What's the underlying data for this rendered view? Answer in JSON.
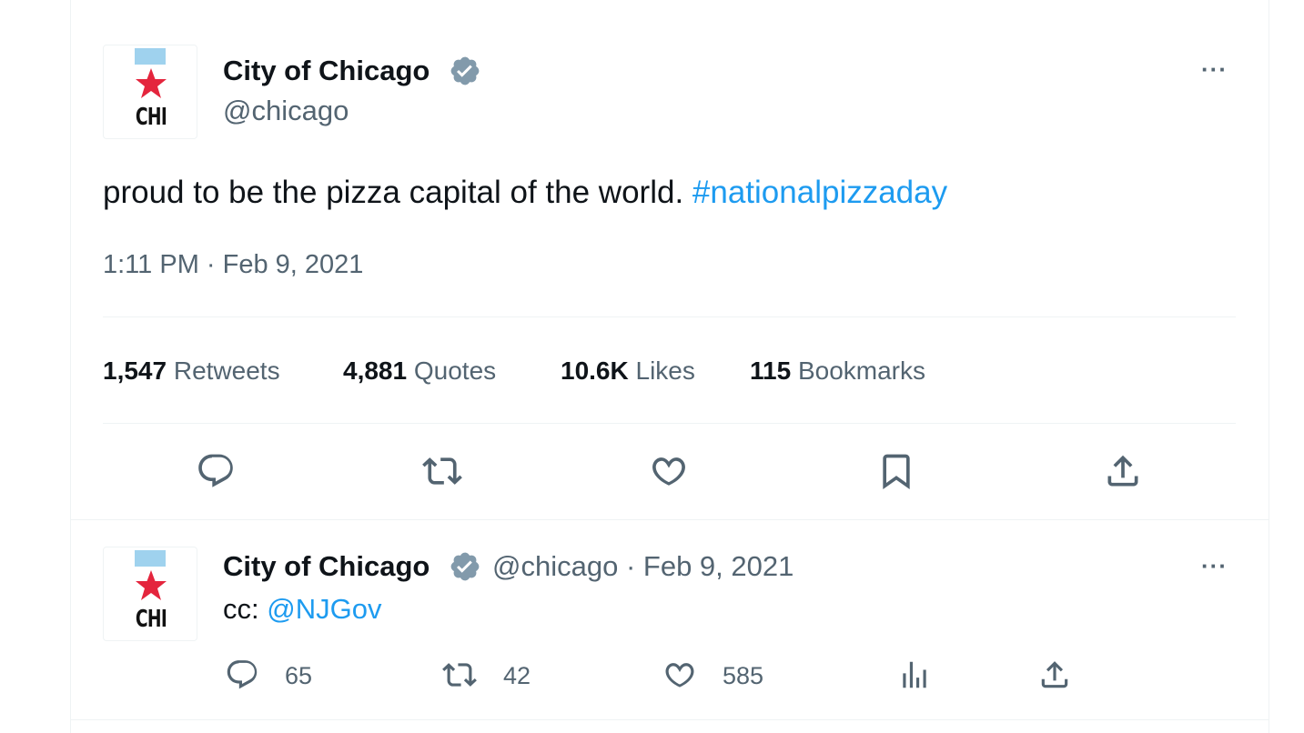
{
  "main_tweet": {
    "author": {
      "name": "City of Chicago",
      "handle": "@chicago",
      "avatar_text": "CHI",
      "verified_icon": "verified-badge-icon"
    },
    "more_label": "···",
    "text_main": "proud to be the pizza capital of the world. ",
    "hashtag": "#nationalpizzaday",
    "timestamp": "1:11 PM · Feb 9, 2021",
    "stats": [
      {
        "value": "1,547",
        "label": "Retweets"
      },
      {
        "value": "4,881",
        "label": "Quotes"
      },
      {
        "value": "10.6K",
        "label": "Likes"
      },
      {
        "value": "115",
        "label": "Bookmarks"
      }
    ],
    "actions": [
      "reply-icon",
      "retweet-icon",
      "like-icon",
      "bookmark-icon",
      "share-icon"
    ]
  },
  "reply_tweet": {
    "author": {
      "name": "City of Chicago",
      "handle": "@chicago",
      "date": "· Feb 9, 2021",
      "avatar_text": "CHI"
    },
    "more_label": "···",
    "text_prefix": "cc: ",
    "mention": "@NJGov",
    "counts": {
      "replies": "65",
      "retweets": "42",
      "likes": "585"
    },
    "actions": [
      "reply-icon",
      "retweet-icon",
      "like-icon",
      "analytics-icon",
      "share-icon"
    ]
  },
  "colors": {
    "link": "#1d9bf0",
    "secondary_text": "#536471",
    "primary_text": "#0f1419",
    "divider": "#eff3f4",
    "chicago_blue": "#9fd2ee",
    "chicago_red": "#e4253d"
  }
}
